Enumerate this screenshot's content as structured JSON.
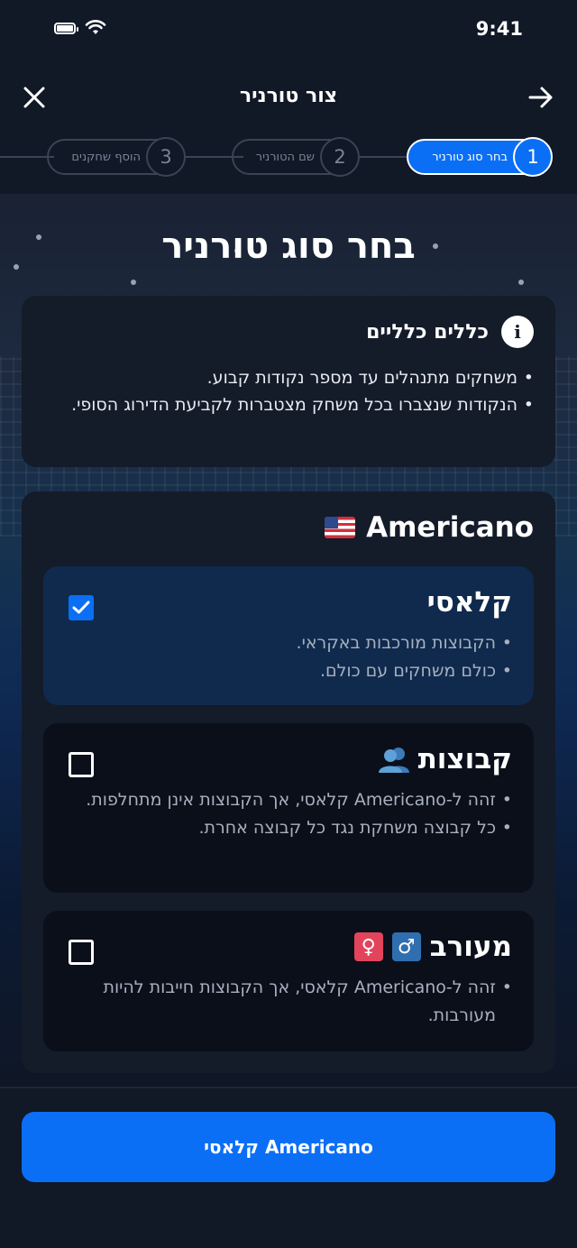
{
  "status_bar": {
    "time": "9:41",
    "icons": [
      "battery-icon",
      "wifi-icon"
    ]
  },
  "nav": {
    "title": "צור טורניר",
    "close_icon": "close-icon",
    "back_icon": "arrow-right-icon"
  },
  "stepper": {
    "steps": [
      {
        "number": "1",
        "label": "בחר סוג טורניר",
        "active": true
      },
      {
        "number": "2",
        "label": "שם הטורניר",
        "active": false
      },
      {
        "number": "3",
        "label": "הוסף שחקנים",
        "active": false
      }
    ]
  },
  "heading": "בחר סוג טורניר",
  "general_rules": {
    "title": "כללים כלליים",
    "items": [
      "משחקים מתנהלים עד מספר נקודות קבוע.",
      "הנקודות שנצברו בכל משחק מצטברות לקביעת הדירוג הסופי."
    ]
  },
  "americano": {
    "title": "Americano",
    "flag": "us-flag-icon",
    "options": [
      {
        "title": "קלאסי",
        "selected": true,
        "items": [
          "הקבוצות מורכבות באקראי.",
          "כולם משחקים עם כולם."
        ]
      },
      {
        "title": "קבוצות",
        "selected": false,
        "icon": "people-icon",
        "items": [
          "זהה ל-Americano קלאסי, אך הקבוצות אינן מתחלפות.",
          "כל קבוצה משחקת נגד כל קבוצה אחרת."
        ]
      },
      {
        "title": "מעורב",
        "selected": false,
        "symbols": {
          "male": "♂",
          "female": "♀"
        },
        "items": [
          "זהה ל-Americano קלאסי, אך הקבוצות חייבות להיות מעורבות."
        ]
      }
    ]
  },
  "cta": {
    "label": "Americano קלאסי"
  },
  "colors": {
    "accent": "#0a6ff5",
    "background": "#111826",
    "card": "#141b29",
    "selected_card": "#0f2a4d"
  }
}
